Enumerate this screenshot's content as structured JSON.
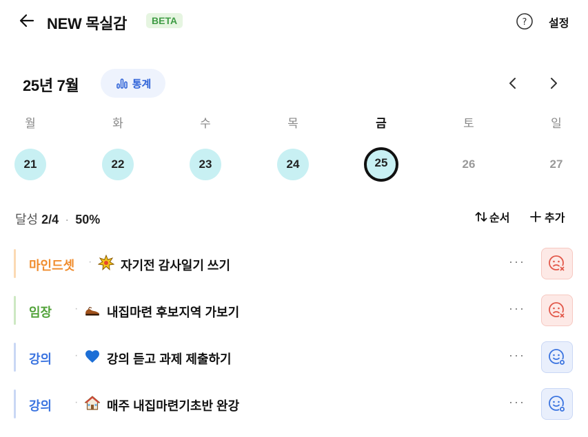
{
  "header": {
    "title": "NEW 목실감",
    "badge": "BETA",
    "settings_label": "설정"
  },
  "calendar": {
    "month_label": "25년 7월",
    "stats_label": "통계",
    "days": [
      {
        "weekday": "월",
        "date": "21",
        "state": "filled"
      },
      {
        "weekday": "화",
        "date": "22",
        "state": "filled"
      },
      {
        "weekday": "수",
        "date": "23",
        "state": "filled"
      },
      {
        "weekday": "목",
        "date": "24",
        "state": "filled"
      },
      {
        "weekday": "금",
        "date": "25",
        "state": "today"
      },
      {
        "weekday": "토",
        "date": "26",
        "state": "future"
      },
      {
        "weekday": "일",
        "date": "27",
        "state": "future"
      }
    ]
  },
  "summary": {
    "label": "달성",
    "count": "2/4",
    "percent": "50%",
    "sort_label": "순서",
    "add_label": "추가"
  },
  "tasks": [
    {
      "category": "마인드셋",
      "title": "자기전 감사일기 쓰기",
      "status": "failed",
      "category_color": "#f08c2d",
      "bar_color": "#fbd9b3",
      "emoji": "sparkle"
    },
    {
      "category": "임장",
      "title": "내집마련 후보지역 가보기",
      "status": "failed",
      "category_color": "#53a33b",
      "bar_color": "#cde8c2",
      "emoji": "shoe"
    },
    {
      "category": "강의",
      "title": "강의 듣고 과제 제출하기",
      "status": "pending",
      "category_color": "#3b74e0",
      "bar_color": "#c9d7f5",
      "emoji": "blue-heart"
    },
    {
      "category": "강의",
      "title": "매주 내집마련기초반 완강",
      "status": "pending",
      "category_color": "#3b74e0",
      "bar_color": "#c9d7f5",
      "emoji": "house"
    }
  ],
  "colors": {
    "accent": "#2f63d8",
    "today_ring": "#111111",
    "day_fill": "#c8f0f3",
    "fail": "#e2584a",
    "pending": "#3b74e0"
  }
}
